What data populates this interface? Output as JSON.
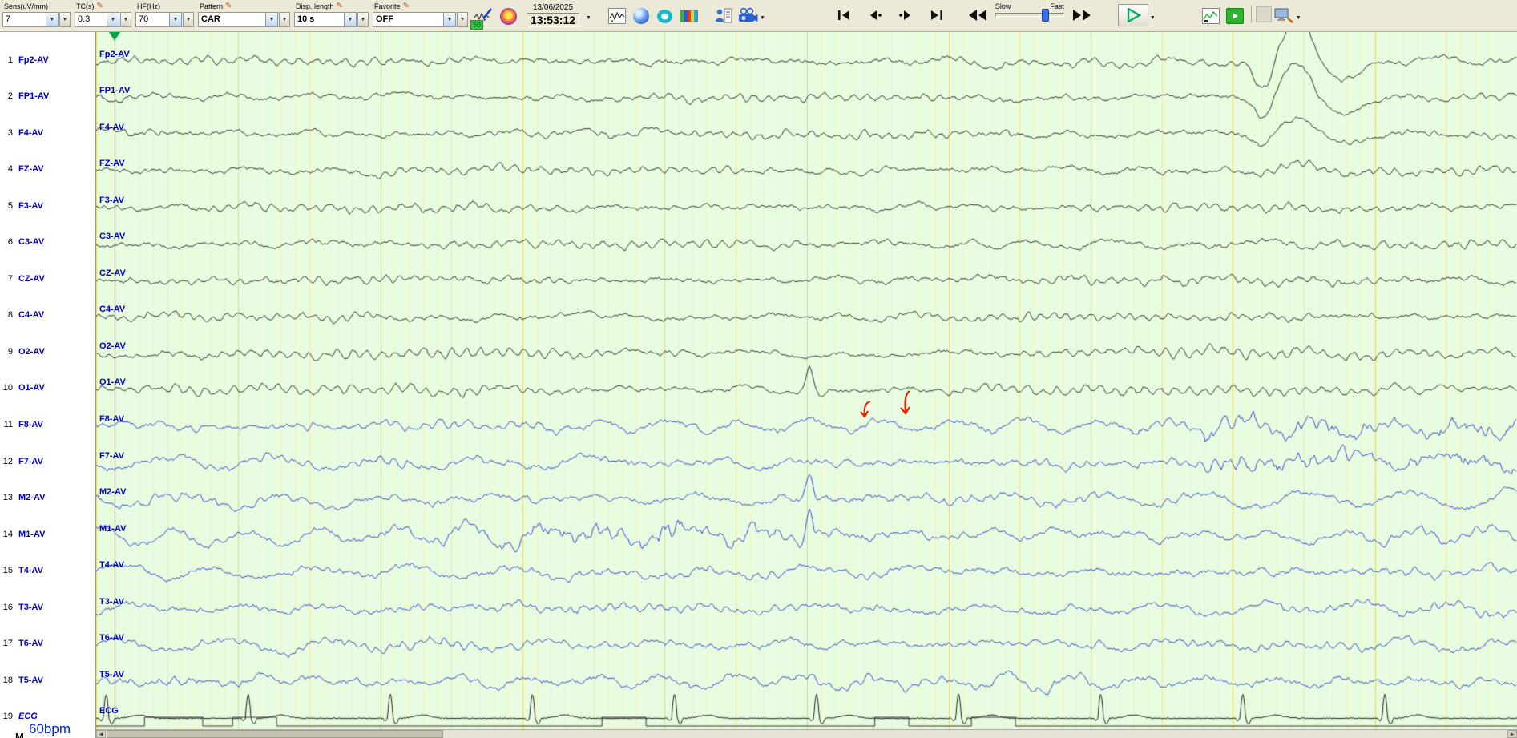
{
  "toolbar": {
    "params": [
      {
        "label": "Sens(uV/mm)",
        "value": "7",
        "bold": false,
        "pencil": false
      },
      {
        "label": "TC(s)",
        "value": "0.3",
        "bold": false,
        "pencil": true
      },
      {
        "label": "HF(Hz)",
        "value": "70",
        "bold": false,
        "pencil": false
      },
      {
        "label": "Pattern",
        "value": "CAR",
        "bold": true,
        "pencil": true
      },
      {
        "label": "Disp. length",
        "value": "10 s",
        "bold": true,
        "pencil": true
      },
      {
        "label": "Favorite",
        "value": "OFF",
        "bold": true,
        "pencil": true
      }
    ],
    "date": "13/06/2025",
    "time": "13:53:12",
    "pen_badge": "50",
    "speed": {
      "slow_label": "Slow",
      "fast_label": "Fast"
    }
  },
  "channels": [
    {
      "num": "1",
      "name": "Fp2-AV",
      "trace_color": "#1b1b1b"
    },
    {
      "num": "2",
      "name": "FP1-AV",
      "trace_color": "#1b1b1b"
    },
    {
      "num": "3",
      "name": "F4-AV",
      "trace_color": "#1b1b1b"
    },
    {
      "num": "4",
      "name": "FZ-AV",
      "trace_color": "#1b1b1b"
    },
    {
      "num": "5",
      "name": "F3-AV",
      "trace_color": "#1b1b1b"
    },
    {
      "num": "6",
      "name": "C3-AV",
      "trace_color": "#1b1b1b"
    },
    {
      "num": "7",
      "name": "CZ-AV",
      "trace_color": "#1b1b1b"
    },
    {
      "num": "8",
      "name": "C4-AV",
      "trace_color": "#1b1b1b"
    },
    {
      "num": "9",
      "name": "O2-AV",
      "trace_color": "#1b1b1b"
    },
    {
      "num": "10",
      "name": "O1-AV",
      "trace_color": "#1b1b1b"
    },
    {
      "num": "11",
      "name": "F8-AV",
      "trace_color": "#2636c8"
    },
    {
      "num": "12",
      "name": "F7-AV",
      "trace_color": "#2636c8"
    },
    {
      "num": "13",
      "name": "M2-AV",
      "trace_color": "#2636c8"
    },
    {
      "num": "14",
      "name": "M1-AV",
      "trace_color": "#2636c8"
    },
    {
      "num": "15",
      "name": "T4-AV",
      "trace_color": "#2636c8"
    },
    {
      "num": "16",
      "name": "T3-AV",
      "trace_color": "#2636c8"
    },
    {
      "num": "17",
      "name": "T6-AV",
      "trace_color": "#2636c8"
    },
    {
      "num": "18",
      "name": "T5-AV",
      "trace_color": "#2636c8"
    },
    {
      "num": "19",
      "name": "ECG",
      "trace_color": "#1b1b1b",
      "italic": true,
      "type": "ecg"
    }
  ],
  "heart_rate": "60bpm",
  "marker_label": "M",
  "display": {
    "seconds": 10,
    "bg": "#e7fce1",
    "grid_major": "#e5dd5f",
    "grid_mid": "#efe994",
    "grid_minor": "#f7f4c2",
    "channel_label_color": "#0000c8",
    "annotation_color": "#e02200",
    "cursor_marker_color": "#00a53c"
  }
}
